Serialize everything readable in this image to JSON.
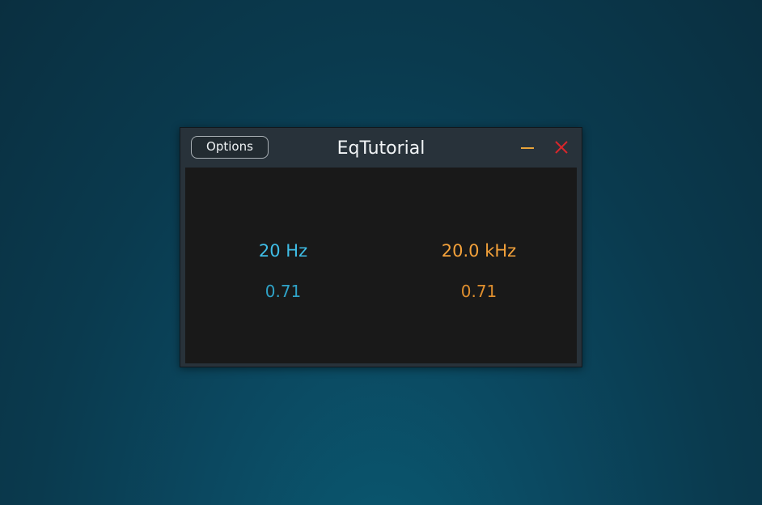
{
  "window": {
    "title": "EqTutorial",
    "options_label": "Options"
  },
  "icons": {
    "minimize": "minimize-icon",
    "close": "close-icon"
  },
  "colors": {
    "low_band": "#3fbde6",
    "high_band": "#f3a13a",
    "minimize": "#e8a43a",
    "close": "#d8262b"
  },
  "bands": {
    "low": {
      "frequency": "20 Hz",
      "q": "0.71"
    },
    "high": {
      "frequency": "20.0 kHz",
      "q": "0.71"
    }
  }
}
